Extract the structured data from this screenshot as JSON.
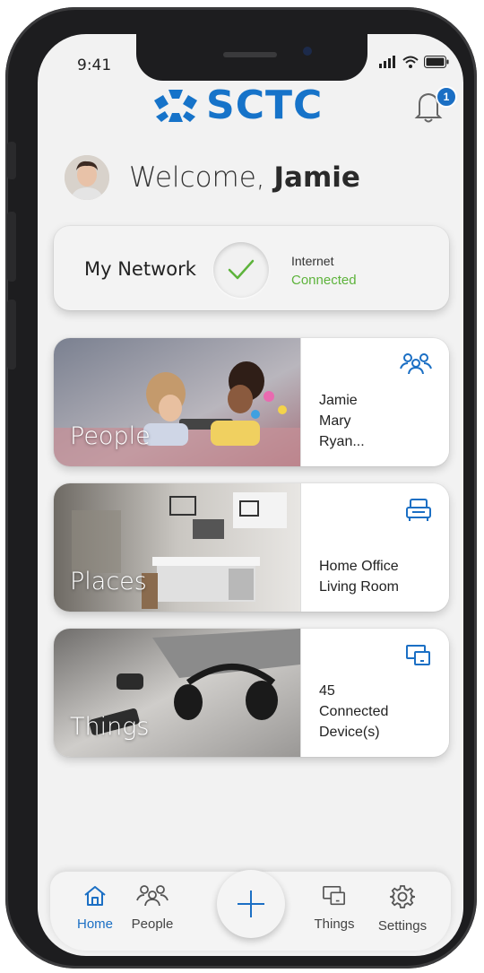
{
  "status": {
    "time": "9:41"
  },
  "header": {
    "logo_text": "SCTC",
    "notification_count": "1"
  },
  "welcome": {
    "greeting": "Welcome,",
    "name": "Jamie"
  },
  "network": {
    "title": "My Network",
    "status_label": "Internet",
    "status_value": "Connected",
    "status_color": "#5db33b"
  },
  "cards": [
    {
      "title": "People",
      "icon": "people-icon",
      "lines": [
        "Jamie",
        "Mary",
        "Ryan..."
      ]
    },
    {
      "title": "Places",
      "icon": "armchair-icon",
      "lines": [
        "Home Office",
        "Living Room"
      ]
    },
    {
      "title": "Things",
      "icon": "devices-icon",
      "lines": [
        "45",
        "Connected",
        "Device(s)"
      ]
    }
  ],
  "tabbar": {
    "tabs": [
      {
        "label": "Home",
        "icon": "home-icon",
        "active": true
      },
      {
        "label": "People",
        "icon": "people-icon"
      },
      {
        "label": "Things",
        "icon": "devices-icon"
      },
      {
        "label": "Settings",
        "icon": "gear-icon"
      }
    ],
    "add_icon": "plus-icon"
  },
  "colors": {
    "accent": "#1b6fc4",
    "logo": "#1673c9",
    "success": "#5db33b"
  }
}
